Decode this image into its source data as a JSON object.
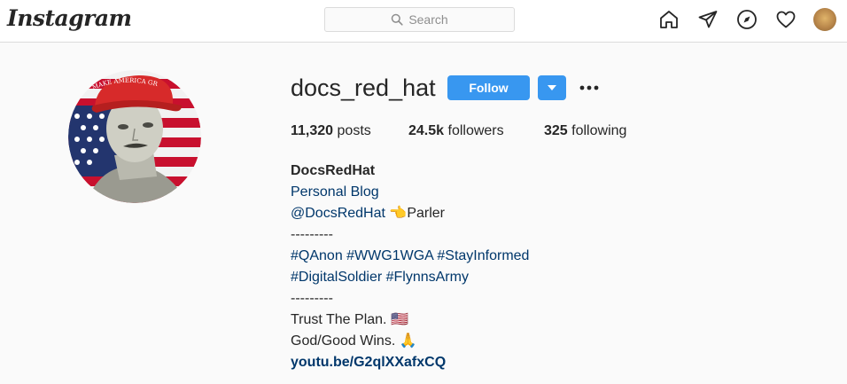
{
  "header": {
    "logo": "Instagram",
    "search_placeholder": "Search",
    "icons": [
      "home-icon",
      "direct-icon",
      "explore-icon",
      "activity-icon",
      "profile-avatar"
    ]
  },
  "profile": {
    "username": "docs_red_hat",
    "follow_label": "Follow",
    "stats": {
      "posts_count": "11,320",
      "posts_label": "posts",
      "followers_count": "24.5k",
      "followers_label": "followers",
      "following_count": "325",
      "following_label": "following"
    },
    "bio": {
      "name": "DocsRedHat",
      "category": "Personal Blog",
      "handle": "@DocsRedHat",
      "handle_emoji": "👈",
      "handle_suffix": "Parler",
      "separator1": "---------",
      "hashtags_line1": "#QAnon #WWG1WGA #StayInformed",
      "hashtags_line2": "#DigitalSoldier #FlynnsArmy",
      "separator2": "---------",
      "line_trust": "Trust The Plan.",
      "line_trust_emoji": "🇺🇸",
      "line_god": "God/Good Wins.",
      "line_god_emoji": "🙏",
      "link": "youtu.be/G2qlXXafxCQ"
    },
    "avatar_hat_text": "MAKE AMERICA GREAT AGAIN"
  },
  "colors": {
    "accent": "#3897f0",
    "link": "#00376b",
    "hat_red": "#d72a2a",
    "text": "#262626"
  }
}
